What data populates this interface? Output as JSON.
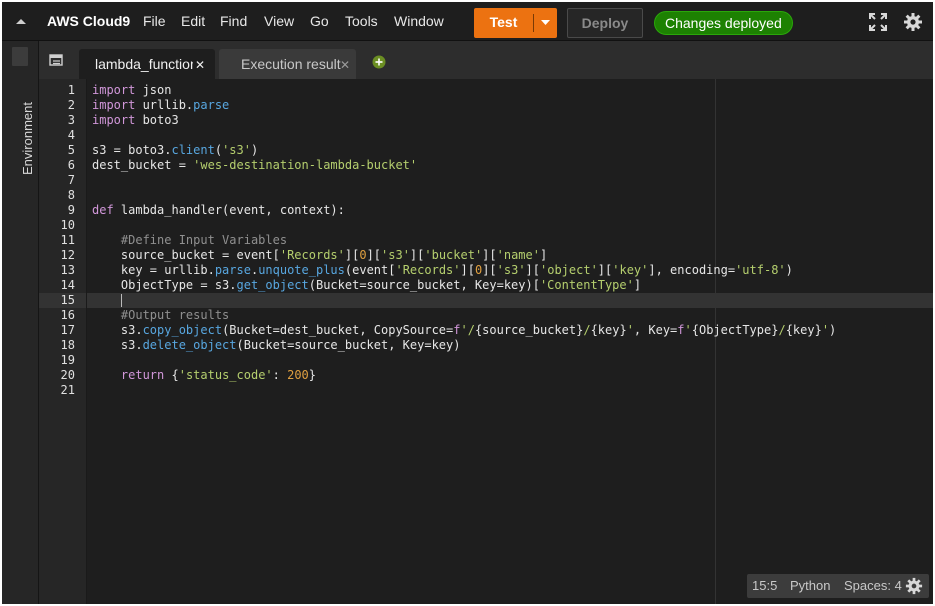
{
  "menubar": {
    "brand": "AWS Cloud9",
    "items": [
      "File",
      "Edit",
      "Find",
      "View",
      "Go",
      "Tools",
      "Window"
    ],
    "test_label": "Test",
    "deploy_label": "Deploy",
    "status": "Changes deployed"
  },
  "sidebar": {
    "environment_label": "Environment"
  },
  "tabs": [
    {
      "label": "lambda_function",
      "active": true
    },
    {
      "label": "Execution results",
      "active": false
    }
  ],
  "editor": {
    "active_line": 15,
    "lines": [
      "import json",
      "import urllib.parse",
      "import boto3",
      "",
      "s3 = boto3.client('s3')",
      "dest_bucket = 'wes-destination-lambda-bucket'",
      "",
      "",
      "def lambda_handler(event, context):",
      "",
      "    #Define Input Variables",
      "    source_bucket = event['Records'][0]['s3']['bucket']['name']",
      "    key = urllib.parse.unquote_plus(event['Records'][0]['s3']['object']['key'], encoding='utf-8')",
      "    ObjectType = s3.get_object(Bucket=source_bucket, Key=key)['ContentType']",
      "",
      "    #Output results",
      "    s3.copy_object(Bucket=dest_bucket, CopySource=f'/{source_bucket}/{key}', Key=f'{ObjectType}/{key}')",
      "    s3.delete_object(Bucket=source_bucket, Key=key)",
      "",
      "    return {'status_code': 200}",
      ""
    ]
  },
  "statusbar": {
    "position": "15:5",
    "language": "Python",
    "indent": "Spaces: 4"
  },
  "colors": {
    "accent": "#ec7211",
    "success": "#1d8102",
    "editor_bg": "#1e1e1e"
  },
  "icons": [
    "collapse-up-icon",
    "chevron-down-icon",
    "fullscreen-icon",
    "gear-icon",
    "tab-list-icon",
    "add-tab-icon"
  ]
}
